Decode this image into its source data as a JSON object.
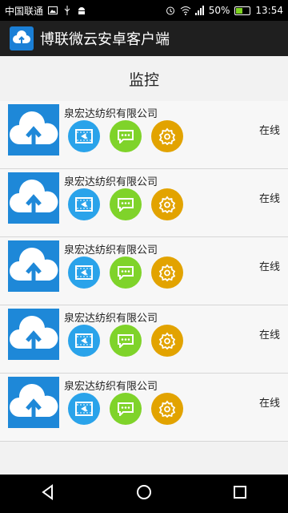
{
  "status_bar": {
    "carrier": "中国联通",
    "battery_percent": "50%",
    "battery_level": 0.5,
    "time": "13:54"
  },
  "app_bar": {
    "title": "博联微云安卓客户端",
    "logo_icon": "cloud-upload-icon"
  },
  "page": {
    "title": "监控"
  },
  "devices": [
    {
      "name": "泉宏达纺织有限公司",
      "status": "在线"
    },
    {
      "name": "泉宏达纺织有限公司",
      "status": "在线"
    },
    {
      "name": "泉宏达纺织有限公司",
      "status": "在线"
    },
    {
      "name": "泉宏达纺织有限公司",
      "status": "在线"
    },
    {
      "name": "泉宏达纺织有限公司",
      "status": "在线"
    }
  ],
  "colors": {
    "thumb_blue": "#1e88d8",
    "video_button": "#2aa3ea",
    "message_button": "#7fd32a",
    "settings_button": "#e2a300"
  },
  "nav": {
    "icons": [
      "back-icon",
      "home-icon",
      "recents-icon"
    ]
  }
}
